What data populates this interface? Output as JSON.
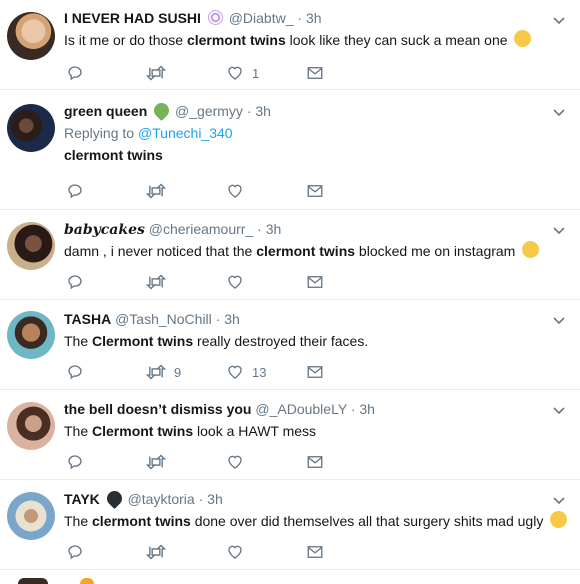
{
  "icons": {
    "reply": "reply-icon",
    "retweet": "retweet-icon",
    "like": "heart-icon",
    "dm": "envelope-icon",
    "more": "chevron-down-icon"
  },
  "colors": {
    "handle": "#657786",
    "link": "#1da1f2",
    "border": "#e6ecf0"
  },
  "tweets": [
    {
      "name": "I NEVER HAD SUSHI",
      "name_emoji": "swirl-emoji",
      "handle": "@Diabtw_",
      "time": "3h",
      "text": [
        {
          "t": "Is it me or do those ",
          "b": false
        },
        {
          "t": "clermont twins",
          "b": true
        },
        {
          "t": " look like they can suck a mean one ",
          "b": false
        }
      ],
      "text_emoji": "weary-face-emoji",
      "replies": "",
      "retweets": "",
      "likes": "1"
    },
    {
      "name": "green queen",
      "name_emoji": "green-heart-emoji",
      "handle": "@_germyy",
      "time": "3h",
      "replying_to": "Replying to",
      "replying_handle": "@Tunechi_340",
      "text": [
        {
          "t": "clermont twins",
          "b": true
        }
      ],
      "replies": "",
      "retweets": "",
      "likes": ""
    },
    {
      "name": "𝒃𝒂𝒃𝒚𝒄𝒂𝒌𝒆𝒔",
      "handle": "@cherieamourr_",
      "time": "3h",
      "text": [
        {
          "t": "damn , i never noticed that the ",
          "b": false
        },
        {
          "t": "clermont twins",
          "b": true
        },
        {
          "t": " blocked me on instagram ",
          "b": false
        }
      ],
      "text_emoji": "joy-face-emoji",
      "replies": "",
      "retweets": "",
      "likes": ""
    },
    {
      "name": "TASHA",
      "handle": "@Tash_NoChill",
      "time": "3h",
      "text": [
        {
          "t": "The ",
          "b": false
        },
        {
          "t": "Clermont twins",
          "b": true
        },
        {
          "t": " really destroyed their faces.",
          "b": false
        }
      ],
      "replies": "",
      "retweets": "9",
      "likes": "13"
    },
    {
      "name": "the bell doesn’t dismiss you",
      "handle": "@_ADoubleLY",
      "time": "3h",
      "text": [
        {
          "t": "The ",
          "b": false
        },
        {
          "t": "Clermont twins",
          "b": true
        },
        {
          "t": " look a HAWT mess",
          "b": false
        }
      ],
      "replies": "",
      "retweets": "",
      "likes": ""
    },
    {
      "name": "TAYK",
      "name_emoji": "black-heart-emoji",
      "handle": "@tayktoria",
      "time": "3h",
      "text": [
        {
          "t": "The ",
          "b": false
        },
        {
          "t": "clermont twins",
          "b": true
        },
        {
          "t": " done over did themselves all that surgery shits mad ugly ",
          "b": false
        }
      ],
      "text_emoji": "confused-face-emoji",
      "replies": "",
      "retweets": "",
      "likes": ""
    }
  ]
}
